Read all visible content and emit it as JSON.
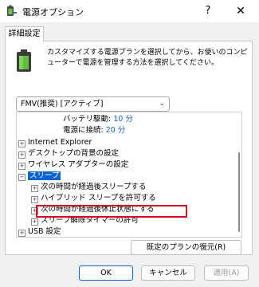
{
  "window": {
    "title": "電源オプション",
    "help": "?",
    "close": "✕"
  },
  "tab": {
    "label": "詳細設定"
  },
  "intro": {
    "text": "カスタマイズする電源プランを選択してから、お使いのコンピューターで電源を管理する方法を選択してください。"
  },
  "plan_select": {
    "value": "FMV(推奨) [アクティブ]"
  },
  "tree": {
    "battery_label": "バッテリ駆動:",
    "battery_value": "10 分",
    "ac_label": "電源に接続:",
    "ac_value": "20 分",
    "internet_explorer": "Internet Explorer",
    "desktop_bg": "デスクトップの背景の設定",
    "wireless": "ワイヤレス アダプターの設定",
    "sleep": "スリープ",
    "sleep_after": "次の時間が経過後スリープする",
    "hybrid_sleep": "ハイブリッド スリープを許可する",
    "hibernate_after": "次の時間が経過後休止状態にする",
    "wake_timers": "スリープ解除タイマーの許可",
    "usb": "USB 設定"
  },
  "buttons": {
    "restore": "既定のプランの復元(R)",
    "ok": "OK",
    "cancel": "キャンセル",
    "apply": "適用(A)"
  }
}
